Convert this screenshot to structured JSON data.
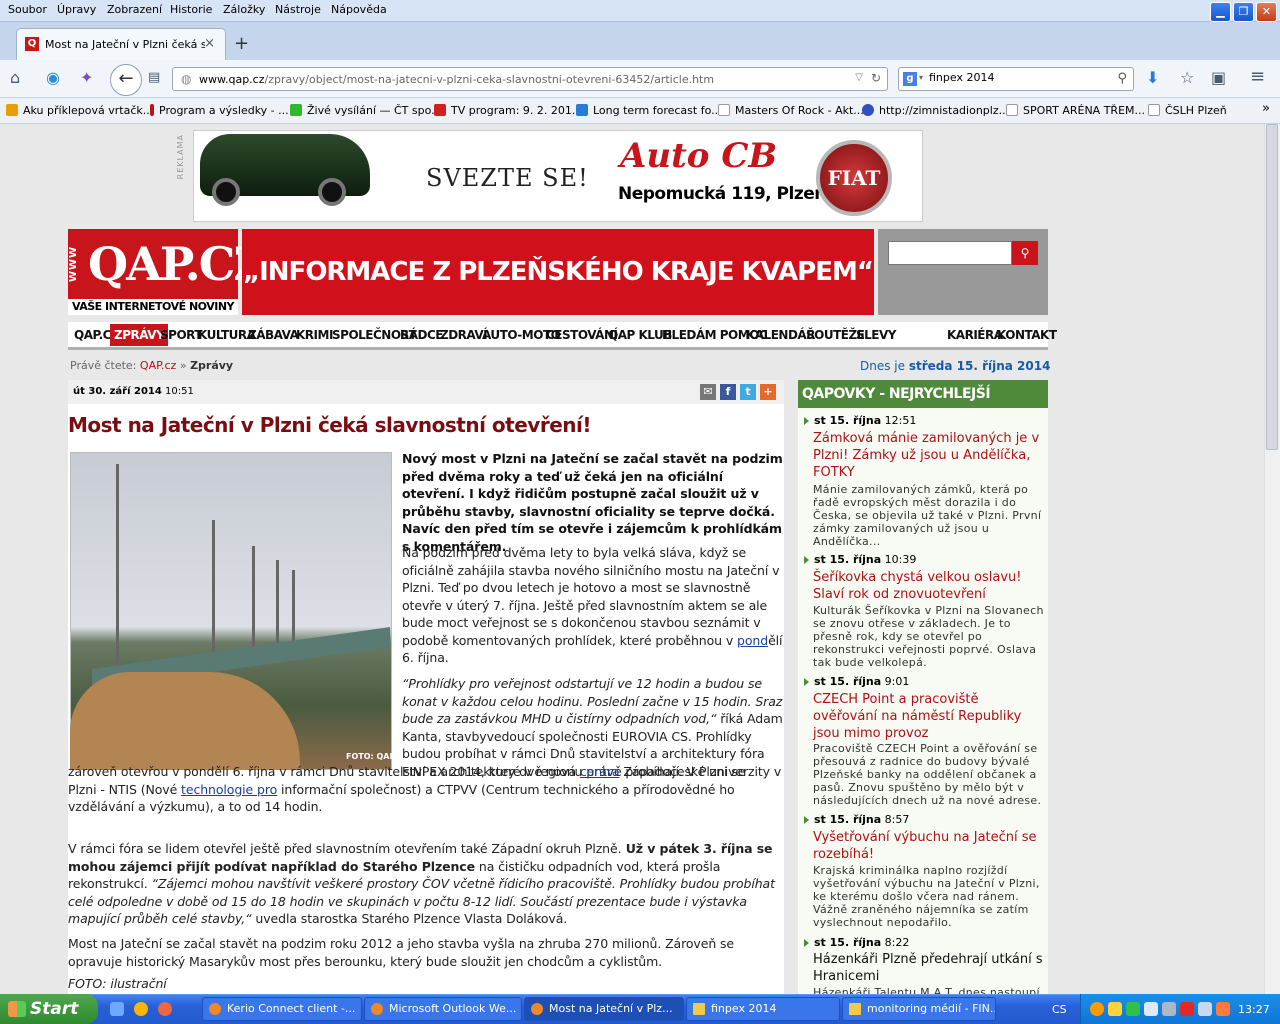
{
  "menubar": {
    "items": [
      "Soubor",
      "Úpravy",
      "Zobrazení",
      "Historie",
      "Záložky",
      "Nástroje",
      "Nápověda"
    ]
  },
  "tab": {
    "title": "Most na Jateční v Plzni čeká sl...",
    "close": "×",
    "new": "+"
  },
  "nav": {
    "url_host": "www.qap.cz",
    "url_path": "/zpravy/object/most-na-jatecni-v-plzni-ceka-slavnostni-otevreni-63452/article.htm",
    "search_value": "finpex 2014"
  },
  "bookmarks": [
    {
      "label": "Aku příklepová vrtačk...",
      "color": "#e8a000"
    },
    {
      "label": "Program a výsledky - ...",
      "color": "#c0141b"
    },
    {
      "label": "Živé vysílání — ČT spo...",
      "color": "#2eb82e"
    },
    {
      "label": "TV program: 9. 2. 201...",
      "color": "#d42020"
    },
    {
      "label": "Long term forecast fo...",
      "color": "#2a7ad8"
    },
    {
      "label": "Masters Of Rock - Akt...",
      "color": "#ffffff"
    },
    {
      "label": "http://zimnistadionplz...",
      "color": "#3050c0"
    },
    {
      "label": "SPORT ARÉNA TŘEM...",
      "color": "#ffffff"
    },
    {
      "label": "ČSLH Plzeň",
      "color": "#ffffff"
    }
  ],
  "ad": {
    "label": "REKLAMA",
    "slogan": "Svezte se!",
    "brand": "Auto CB",
    "address": "Nepomucká 119, Plzeň",
    "logo_text": "FIAT"
  },
  "header": {
    "logo_www": "WWW",
    "logo": "QAP.CZ",
    "logo_sub": "VAŠE INTERNETOVÉ NOVINY",
    "slogan": "„INFORMACE Z PLZEŇSKÉHO KRAJE KVAPEM“",
    "search_placeholder": ""
  },
  "mainnav": [
    "QAP.CZ",
    "ZPRÁVY",
    "SPORT",
    "KULTURA",
    "ZÁBAVA",
    "KRIMI",
    "SPOLEČNOST",
    "RÁDCE",
    "ZDRAVÍ",
    "AUTO-MOTO",
    "CESTOVÁNÍ",
    "QAP KLUB",
    "HLEDÁM POMOC",
    "KALENDÁŘ",
    "SOUTĚŽE",
    "SLEVY",
    "KARIÉRA",
    "KONTAKT"
  ],
  "breadcrumb": {
    "prefix": "Právě čtete:",
    "home": "QAP.cz",
    "sep": "»",
    "current": "Zprávy"
  },
  "today": {
    "prefix": "Dnes je",
    "date": "středa 15. října 2014"
  },
  "article": {
    "date": "út 30. září 2014",
    "time": "10:51",
    "title": "Most na Jateční v Plzni čeká slavnostní otevření!",
    "photo_credit": "FOTO: QAP.CZ",
    "lead": "Nový most v Plzni na Jateční se začal stavět na podzim před dvěma roky a teď už čeká jen na oficiální otevření. I když řidičům postupně začal sloužit už v průběhu stavby, slavnostní oficiality se teprve dočká. Navíc den před tím se otevře i zájemcům k prohlídkám s komentářem.",
    "p1a": "Na podzim před dvěma lety to byla velká sláva, když se oficiálně zahájila stavba nového silničního mostu na Jateční v Plzni. Teď po dvou letech je hotovo a most se slavnostně otevře v úterý 7. října. Ještě před slavnostním aktem se ale bude moct veřejnost se s dokončenou stavbou seznámit v podobě komentovaných prohlídek, které proběhnou v",
    "p1_link": "pond",
    "p1b": "ělí 6. října.",
    "p2_quote": "“Prohlídky pro veřejnost odstartují ve 12 hodin a budou se konat v každou celou hodinu. Poslední začne v 15 hodin. Sraz bude za zastávkou MHD u čistírny odpadních vod,“",
    "p2_rest": " říká Adam Kanta, stavbyvedoucí společnosti EUROVIA CS. Prohlídky budou probíhat v rámci Dnů stavitelství a architektury fóra FINPEX 2014, které v regionu právě probíhají. V Plzni se",
    "p2_wide_a": "zároveň otevřou v pondělí 6. října v rámci Dnů stavitelství a architektury dvě nová",
    "p2_link1": "centra",
    "p2_wide_b": " Západočeské univerzity v Plzni - NTIS (Nové",
    "p2_link2": "technologie pro",
    "p2_wide_c": " informační společnost) a CTPVV (Centrum technického a přírodovědné ho vzdělávání a výzkumu), a to od 14 hodin.",
    "p3_a": "V rámci fóra se lidem otevřel ještě před slavnostním otevřením také Západní okruh Plzně.",
    "p3_bold": " Už v pátek 3. října se mohou zájemci přijít podívat například do Starého Plzence",
    "p3_b": " na čističku odpadních vod, která prošla rekonstrukcí.",
    "p3_quote": "“Zájemci mohou navštívit veškeré prostory ČOV včetně řídicího pracoviště. Prohlídky budou probíhat celé odpoledne v době od 15 do 18 hodin ve skupinách v počtu 8-12 lidí. Součástí prezentace bude i výstavka mapující průběh celé stavby,“",
    "p3_c": " uvedla starostka Starého Plzence Vlasta Doláková.",
    "p4": "Most na Jateční se začal stavět na podzim roku 2012 a jeho stavba vyšla na zhruba 270 milionů. Zároveň se opravuje historický Masarykův most přes berounku, který bude sloužit jen chodcům a cyklistům.",
    "foto": "FOTO: ilustrační"
  },
  "sidebar": {
    "title": "QAPOVKY - NEJRYCHLEJŠÍ ZPRÁVY",
    "items": [
      {
        "day": "st 15. října",
        "time": "12:51",
        "title": "Zámková mánie zamilovaných je v Plzni! Zámky už jsou u Andělíčka, FOTKY",
        "text": "Mánie zamilovaných zámků, která po řadě evropských měst dorazila i do Česka, se objevila už také v Plzni. První zámky zamilovaných už jsou u Andělíčka..."
      },
      {
        "day": "st 15. října",
        "time": "10:39",
        "title": "Šeříkovka chystá velkou oslavu! Slaví rok od znovuotevření",
        "text": "Kulturák Šeříkovka v Plzni na Slovanech se znovu otřese v základech. Je to přesně rok, kdy se otevřel po rekonstrukci veřejnosti poprvé. Oslava tak bude velkolepá."
      },
      {
        "day": "st 15. října",
        "time": "9:01",
        "title": "CZECH Point a pracoviště ověřování na náměstí Republiky jsou mimo provoz",
        "text": "Pracoviště CZECH Point a ověřování se přesouvá z radnice do budovy bývalé Plzeňské banky na oddělení občanek a pasů. Znovu spuštěno by mělo být v následujících dnech už na nové adrese."
      },
      {
        "day": "st 15. října",
        "time": "8:57",
        "title": "Vyšetřování výbuchu na Jateční se rozebíhá!",
        "text": "Krajská kriminálka naplno rozjíždí vyšetřování výbuchu na Jateční v Plzni, ke kterému došlo včera nad ránem. Vážně zraněného nájemníka se zatím vyslechnout nepodařilo."
      },
      {
        "day": "st 15. října",
        "time": "8:22",
        "title": "Házenkáři Plzně předehrají utkání s Hranicemi",
        "text": "Házenkáři Talentu M.A.T. dnes nastoupí"
      }
    ]
  },
  "taskbar": {
    "start": "Start",
    "items": [
      "Kerio Connect client -...",
      "Microsoft Outlook We...",
      "Most na Jateční v Plz...",
      "finpex 2014",
      "monitoring médií - FIN..."
    ],
    "lang": "CS",
    "clock": "13:27"
  }
}
